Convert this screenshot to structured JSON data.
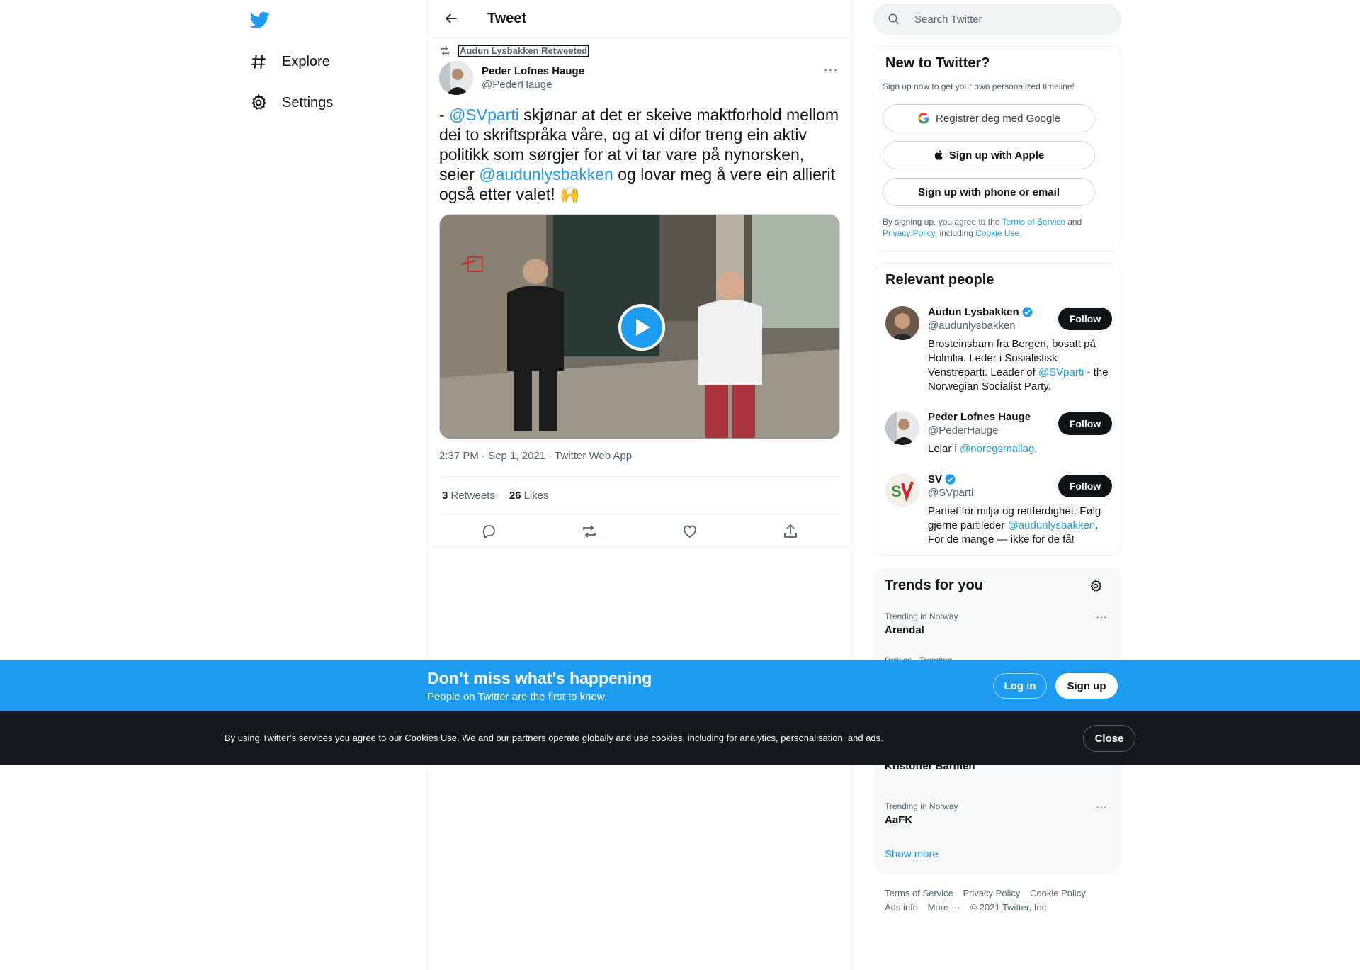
{
  "nav": {
    "items": [
      {
        "label": "Explore",
        "icon": "hashtag-icon"
      },
      {
        "label": "Settings",
        "icon": "gear-icon"
      }
    ]
  },
  "header": {
    "title": "Tweet"
  },
  "tweet": {
    "retweeted_by": "Audun Lysbakken Retweeted",
    "author_name": "Peder Lofnes Hauge",
    "author_handle": "@PederHauge",
    "text_parts": {
      "p1": "- ",
      "mention1": "@SVparti",
      "p2": "  skjønar at det er skeive maktforhold mellom dei to skriftspråka våre, og at vi difor treng ein aktiv politikk som sørgjer for at vi tar vare på nynorsken, seier ",
      "mention2": "@audunlysbakken",
      "p3": " og lovar meg å vere ein allierit også etter valet! 🙌"
    },
    "meta": "2:37 PM · Sep 1, 2021 · Twitter Web App",
    "retweets_count": "3",
    "retweets_label": "Retweets",
    "likes_count": "26",
    "likes_label": "Likes"
  },
  "search": {
    "placeholder": "Search Twitter"
  },
  "new_to_twitter": {
    "title": "New to Twitter?",
    "subtitle": "Sign up now to get your own personalized timeline!",
    "google_label": "Registrer deg med Google",
    "apple_label": "Sign up with Apple",
    "phone_label": "Sign up with phone or email",
    "terms_prefix": "By signing up, you agree to the ",
    "terms_link": "Terms of Service",
    "terms_and": " and ",
    "privacy_link": "Privacy Policy",
    "terms_including": ", including ",
    "cookie_link": "Cookie Use."
  },
  "relevant_people": {
    "title": "Relevant people",
    "follow_label": "Follow",
    "people": [
      {
        "name": "Audun Lysbakken",
        "handle": "@audunlysbakken",
        "verified": true,
        "bio_a": "Brosteinsbarn fra Bergen, bosatt på Holmlia. Leder i Sosialistisk Venstreparti. Leader of ",
        "bio_link": "@SVparti",
        "bio_b": " - the Norwegian Socialist Party."
      },
      {
        "name": "Peder Lofnes Hauge",
        "handle": "@PederHauge",
        "verified": false,
        "bio_a": "Leiar i ",
        "bio_link": "@noregsmallag",
        "bio_b": "."
      },
      {
        "name": "SV",
        "handle": "@SVparti",
        "verified": true,
        "bio_a": "Partiet for miljø og rettferdighet. Følg gjerne partileder ",
        "bio_link": "@audunlysbakken",
        "bio_b": ". For de mange — ikke for de få!"
      }
    ]
  },
  "trends": {
    "title": "Trends for you",
    "items": [
      {
        "context": "Trending in Norway",
        "name": "Arendal"
      },
      {
        "context": "Politics · Trending",
        "name": ""
      },
      {
        "context": "",
        "name": "Kristoffer Barmen"
      },
      {
        "context": "Trending in Norway",
        "name": "AaFK"
      }
    ],
    "show_more": "Show more"
  },
  "footer": {
    "links": [
      "Terms of Service",
      "Privacy Policy",
      "Cookie Policy",
      "Ads info",
      "More ···"
    ],
    "copyright": "© 2021 Twitter, Inc."
  },
  "banner": {
    "title": "Don’t miss what’s happening",
    "subtitle": "People on Twitter are the first to know.",
    "login_label": "Log in",
    "signup_label": "Sign up"
  },
  "cookie": {
    "text": "By using Twitter’s services you agree to our Cookies Use. We and our partners operate globally and use cookies, including for analytics, personalisation, and ads.",
    "close_label": "Close"
  },
  "colors": {
    "accent": "#1d9bf0",
    "text": "#0f1419",
    "secondary": "#536471",
    "cookie_bg": "#15181c"
  }
}
